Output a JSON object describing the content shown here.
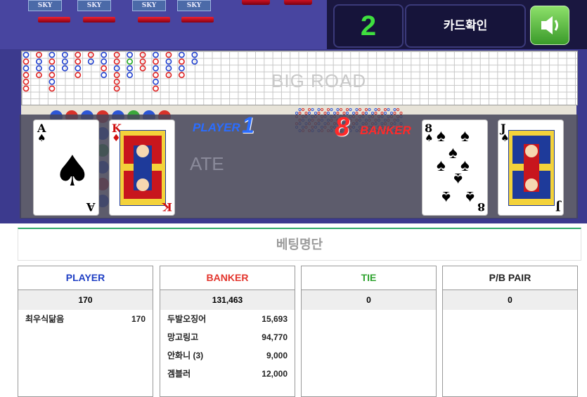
{
  "top": {
    "chips": [
      "SKY",
      "SKY",
      "SKY",
      "SKY"
    ],
    "round_number": "2",
    "confirm_label": "카드확인",
    "sound_icon": "speaker-icon"
  },
  "road": {
    "label": "BIG ROAD"
  },
  "table_view": {
    "plate_label": "ATE",
    "player_label": "PLAYER",
    "player_score": "1",
    "banker_label": "BANKER",
    "banker_score": "8",
    "player_cards": [
      {
        "rank": "A",
        "suit": "♠",
        "color": "#000000"
      },
      {
        "rank": "K",
        "suit": "♦",
        "color": "#d01010"
      }
    ],
    "banker_cards": [
      {
        "rank": "8",
        "suit": "♠",
        "color": "#000000"
      },
      {
        "rank": "J",
        "suit": "♠",
        "color": "#000000"
      }
    ]
  },
  "betting": {
    "title": "베팅명단",
    "columns": [
      {
        "header": "PLAYER",
        "color": "#1f3fc4",
        "total": "170",
        "rows": [
          {
            "name": "최우식닮음",
            "amount": "170"
          }
        ]
      },
      {
        "header": "BANKER",
        "color": "#e3352d",
        "total": "131,463",
        "rows": [
          {
            "name": "두발오징어",
            "amount": "15,693"
          },
          {
            "name": "망고링고",
            "amount": "94,770"
          },
          {
            "name": "안화니 (3)",
            "amount": "9,000"
          },
          {
            "name": "겜블러",
            "amount": "12,000"
          }
        ]
      },
      {
        "header": "TIE",
        "color": "#2fa32f",
        "total": "0",
        "rows": []
      },
      {
        "header": "P/B PAIR",
        "color": "#222222",
        "total": "0",
        "rows": []
      }
    ]
  }
}
